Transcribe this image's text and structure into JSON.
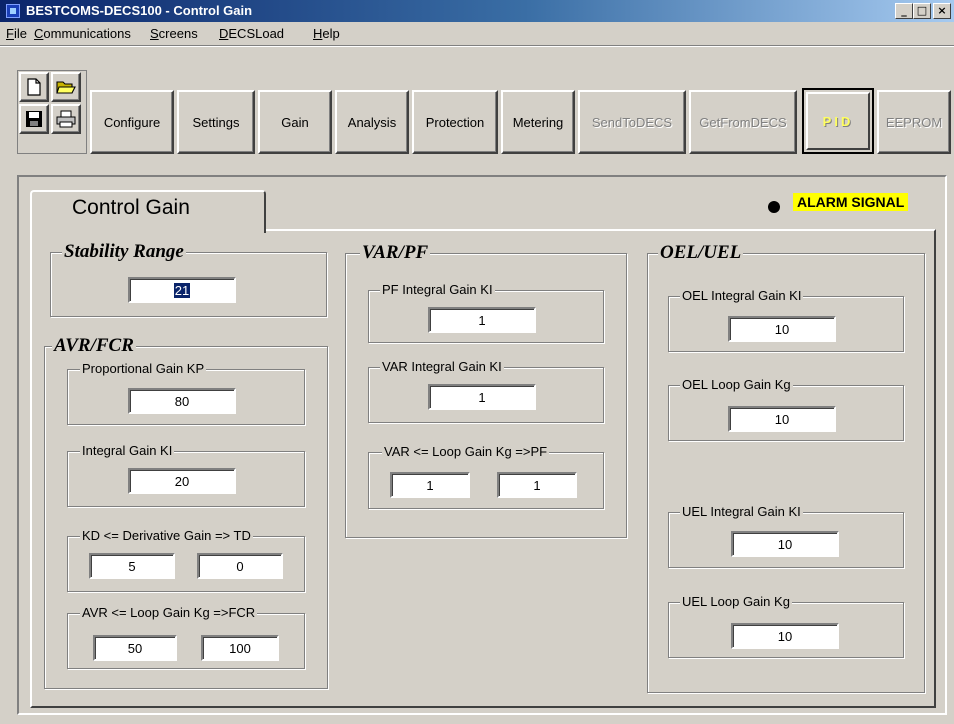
{
  "window": {
    "title": "BESTCOMS-DECS100 - Control Gain",
    "controls": {
      "minimize": "_",
      "maximize": "□",
      "close": "×"
    }
  },
  "menu": [
    {
      "label": "File",
      "mnemonic": "F",
      "rest": "ile"
    },
    {
      "label": "Communications",
      "mnemonic": "C",
      "rest": "ommunications"
    },
    {
      "label": "Screens",
      "mnemonic": "S",
      "rest": "creens"
    },
    {
      "label": "DECSLoad",
      "mnemonic": "D",
      "rest": "ECSLoad"
    },
    {
      "label": "Help",
      "mnemonic": "H",
      "rest": "elp"
    }
  ],
  "toolbar": {
    "icons": [
      "new-file-icon",
      "open-folder-icon",
      "save-icon",
      "print-icon"
    ],
    "buttons": {
      "configure": "Configure",
      "settings": "Settings",
      "gain": "Gain",
      "analysis": "Analysis",
      "protection": "Protection",
      "metering": "Metering",
      "send_to_decs": "SendToDECS",
      "get_from_decs": "GetFromDECS",
      "pid": "PID",
      "eeprom": "EEPROM"
    }
  },
  "tab": {
    "label": "Control Gain"
  },
  "alarm": {
    "label": "ALARM SIGNAL",
    "indicator_color": "#000000",
    "highlight_color": "#ffff00"
  },
  "stability": {
    "title": "Stability Range",
    "value": "21"
  },
  "avr_fcr": {
    "title": "AVR/FCR",
    "proportional_gain": {
      "label": "Proportional Gain KP",
      "value": "80"
    },
    "integral_gain": {
      "label": "Integral Gain KI",
      "value": "20"
    },
    "derivative_gain": {
      "label": "KD <= Derivative Gain => TD",
      "kd": "5",
      "td": "0"
    },
    "loop_gain": {
      "label": "AVR <= Loop Gain Kg =>FCR",
      "avr": "50",
      "fcr": "100"
    }
  },
  "var_pf": {
    "title": "VAR/PF",
    "pf_integral": {
      "label": "PF Integral Gain KI",
      "value": "1"
    },
    "var_integral": {
      "label": "VAR Integral Gain KI",
      "value": "1"
    },
    "loop_gain": {
      "label": "VAR <= Loop Gain Kg =>PF",
      "var": "1",
      "pf": "1"
    }
  },
  "oel_uel": {
    "title": "OEL/UEL",
    "oel_integral": {
      "label": "OEL Integral Gain KI",
      "value": "10"
    },
    "oel_loop": {
      "label": "OEL Loop Gain Kg",
      "value": "10"
    },
    "uel_integral": {
      "label": "UEL Integral Gain KI",
      "value": "10"
    },
    "uel_loop": {
      "label": "UEL Loop Gain Kg",
      "value": "10"
    }
  }
}
